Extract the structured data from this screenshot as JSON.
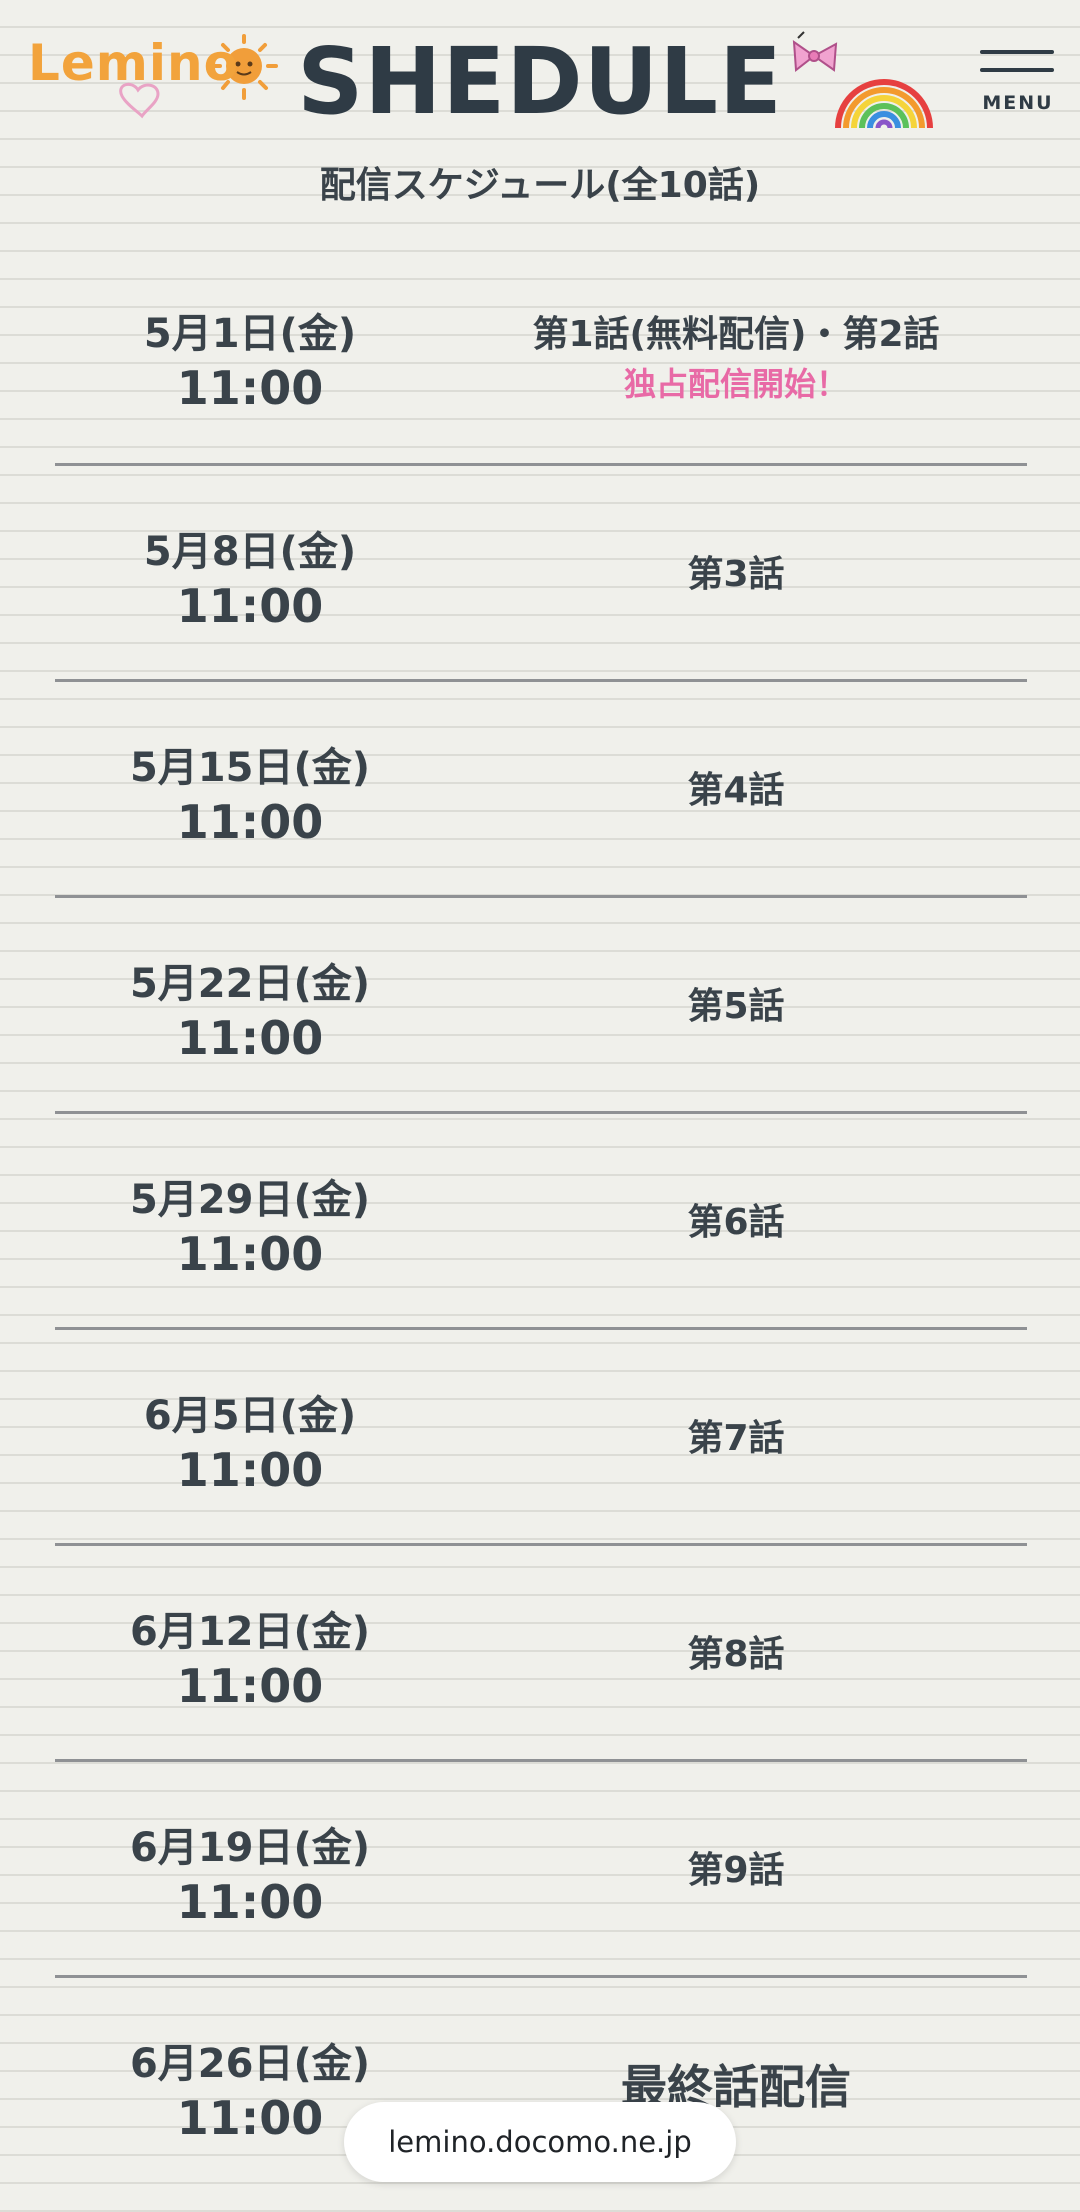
{
  "header": {
    "logo_text": "Lemino",
    "title": "SHEDULE",
    "menu_label": "MENU"
  },
  "subtitle": "配信スケジュール(全10話)",
  "schedule": [
    {
      "date": "5月1日(金)",
      "time": "11:00",
      "episode": "第1話(無料配信)・第2話",
      "note": "独占配信開始！"
    },
    {
      "date": "5月8日(金)",
      "time": "11:00",
      "episode": "第3話"
    },
    {
      "date": "5月15日(金)",
      "time": "11:00",
      "episode": "第4話"
    },
    {
      "date": "5月22日(金)",
      "time": "11:00",
      "episode": "第5話"
    },
    {
      "date": "5月29日(金)",
      "time": "11:00",
      "episode": "第6話"
    },
    {
      "date": "6月5日(金)",
      "time": "11:00",
      "episode": "第7話"
    },
    {
      "date": "6月12日(金)",
      "time": "11:00",
      "episode": "第8話"
    },
    {
      "date": "6月19日(金)",
      "time": "11:00",
      "episode": "第9話"
    },
    {
      "date": "6月26日(金)",
      "time": "11:00",
      "episode": "最終話配信"
    }
  ],
  "url_bar": "lemino.docomo.ne.jp",
  "colors": {
    "background": "#f0f0eb",
    "title": "#2f3b45",
    "logo": "#f2a33c",
    "note_pink": "#e86aa6",
    "divider": "#8f9194"
  },
  "icons": [
    "sun-icon",
    "heart-icon",
    "ribbon-icon",
    "rainbow-icon",
    "menu-icon"
  ]
}
